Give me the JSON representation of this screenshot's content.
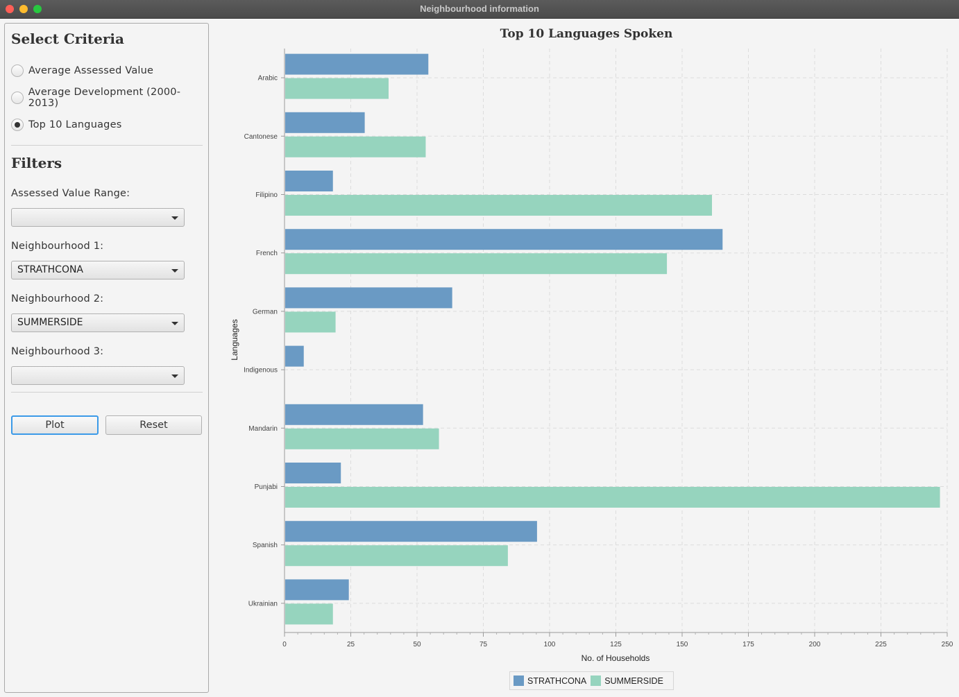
{
  "window": {
    "title": "Neighbourhood information"
  },
  "criteria": {
    "title": "Select Criteria",
    "options": [
      {
        "label": "Average Assessed Value",
        "checked": false
      },
      {
        "label": "Average Development (2000-2013)",
        "checked": false
      },
      {
        "label": "Top 10 Languages",
        "checked": true
      }
    ]
  },
  "filters": {
    "title": "Filters",
    "assessed_range_label": "Assessed Value Range:",
    "assessed_range_value": "",
    "neighbourhood1_label": "Neighbourhood 1:",
    "neighbourhood1_value": "STRATHCONA",
    "neighbourhood2_label": "Neighbourhood 2:",
    "neighbourhood2_value": "SUMMERSIDE",
    "neighbourhood3_label": "Neighbourhood 3:",
    "neighbourhood3_value": ""
  },
  "buttons": {
    "plot": "Plot",
    "reset": "Reset"
  },
  "chart_data": {
    "type": "bar",
    "orientation": "horizontal",
    "title": "Top 10 Languages Spoken",
    "xlabel": "No. of Households",
    "ylabel": "Languages",
    "xlim": [
      0,
      250
    ],
    "xticks": [
      0,
      25,
      50,
      75,
      100,
      125,
      150,
      175,
      200,
      225,
      250
    ],
    "grid": true,
    "legend_position": "bottom",
    "categories": [
      "Arabic",
      "Cantonese",
      "Filipino",
      "French",
      "German",
      "Indigenous",
      "Mandarin",
      "Punjabi",
      "Spanish",
      "Ukrainian"
    ],
    "series": [
      {
        "name": "STRATHCONA",
        "color": "#6a9ac4",
        "values": [
          54,
          30,
          18,
          165,
          63,
          7,
          52,
          21,
          95,
          24
        ]
      },
      {
        "name": "SUMMERSIDE",
        "color": "#96d4be",
        "values": [
          39,
          53,
          161,
          144,
          19,
          0,
          58,
          247,
          84,
          18
        ]
      }
    ]
  }
}
